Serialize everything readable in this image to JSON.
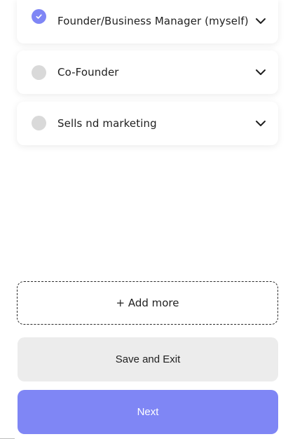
{
  "roles": [
    {
      "label": "Founder/Business Manager (myself)",
      "checked": true
    },
    {
      "label": "Co-Founder",
      "checked": false
    },
    {
      "label": "Sells nd marketing",
      "checked": false
    }
  ],
  "add_more_label": "+ Add more",
  "buttons": {
    "save_exit": "Save and Exit",
    "next": "Next"
  },
  "colors": {
    "accent": "#7f86f5",
    "unchecked": "#d9d9d9",
    "secondary_button": "#ececec"
  },
  "icons": {
    "check": "check-icon",
    "chevron": "chevron-down-icon"
  }
}
